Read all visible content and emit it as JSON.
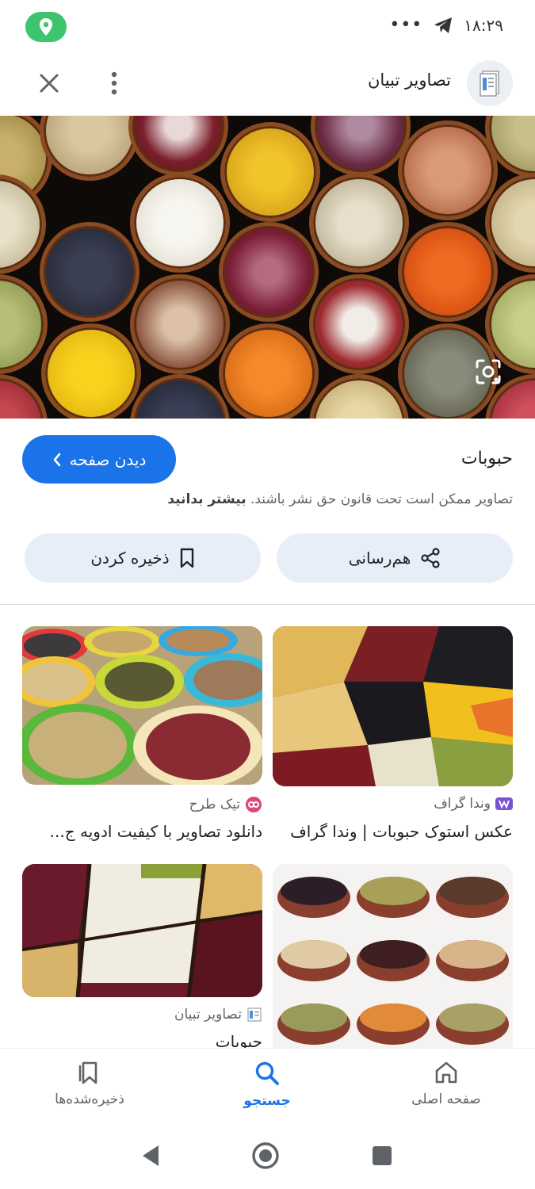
{
  "status_bar": {
    "time": "۱۸:۲۹",
    "dots": "•••"
  },
  "header": {
    "site_name": "تصاویر تبیان",
    "icons": [
      "close-icon",
      "more-vert-icon",
      "site-favicon"
    ]
  },
  "result": {
    "title": "حبوبات",
    "visit_label": "دیدن صفحه",
    "copyright_text": "تصاویر ممکن است تحت قانون حق نشر باشند.",
    "learn_more": "بیشتر بدانید",
    "share_label": "هم‌رسانی",
    "save_label": "ذخیره کردن"
  },
  "related": [
    {
      "source": "وندا گراف",
      "title": "عکس استوک حبوبات | وندا گراف"
    },
    {
      "source": "تیک طرح",
      "title": "دانلود تصاویر با کیفیت ادویه ج..."
    },
    {
      "source": "",
      "title": ""
    },
    {
      "source": "تصاویر تبیان",
      "title": "حبوبات"
    }
  ],
  "bottom_nav": {
    "home": "صفحه اصلی",
    "search": "جستجو",
    "saved": "ذخیره‌شده‌ها",
    "active": "search"
  },
  "colors": {
    "accent": "#1a73e8",
    "location_pill": "#3ec46d",
    "chip_bg": "#e8eef7"
  }
}
